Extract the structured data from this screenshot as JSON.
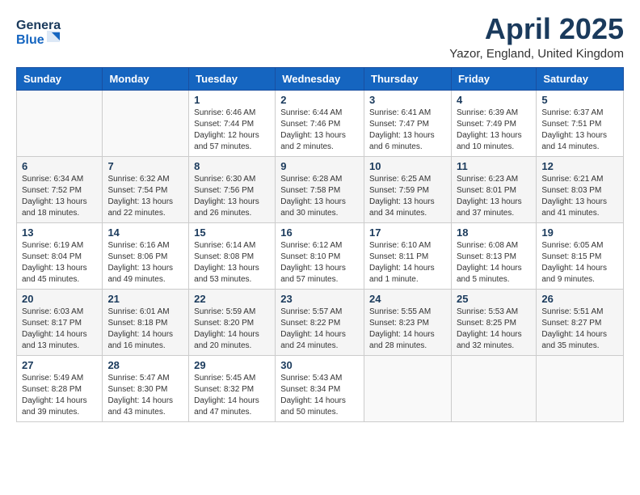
{
  "header": {
    "logo_line1": "General",
    "logo_line2": "Blue",
    "month_title": "April 2025",
    "location": "Yazor, England, United Kingdom"
  },
  "weekdays": [
    "Sunday",
    "Monday",
    "Tuesday",
    "Wednesday",
    "Thursday",
    "Friday",
    "Saturday"
  ],
  "rows": [
    [
      {
        "day": "",
        "sunrise": "",
        "sunset": "",
        "daylight": ""
      },
      {
        "day": "",
        "sunrise": "",
        "sunset": "",
        "daylight": ""
      },
      {
        "day": "1",
        "sunrise": "Sunrise: 6:46 AM",
        "sunset": "Sunset: 7:44 PM",
        "daylight": "Daylight: 12 hours and 57 minutes."
      },
      {
        "day": "2",
        "sunrise": "Sunrise: 6:44 AM",
        "sunset": "Sunset: 7:46 PM",
        "daylight": "Daylight: 13 hours and 2 minutes."
      },
      {
        "day": "3",
        "sunrise": "Sunrise: 6:41 AM",
        "sunset": "Sunset: 7:47 PM",
        "daylight": "Daylight: 13 hours and 6 minutes."
      },
      {
        "day": "4",
        "sunrise": "Sunrise: 6:39 AM",
        "sunset": "Sunset: 7:49 PM",
        "daylight": "Daylight: 13 hours and 10 minutes."
      },
      {
        "day": "5",
        "sunrise": "Sunrise: 6:37 AM",
        "sunset": "Sunset: 7:51 PM",
        "daylight": "Daylight: 13 hours and 14 minutes."
      }
    ],
    [
      {
        "day": "6",
        "sunrise": "Sunrise: 6:34 AM",
        "sunset": "Sunset: 7:52 PM",
        "daylight": "Daylight: 13 hours and 18 minutes."
      },
      {
        "day": "7",
        "sunrise": "Sunrise: 6:32 AM",
        "sunset": "Sunset: 7:54 PM",
        "daylight": "Daylight: 13 hours and 22 minutes."
      },
      {
        "day": "8",
        "sunrise": "Sunrise: 6:30 AM",
        "sunset": "Sunset: 7:56 PM",
        "daylight": "Daylight: 13 hours and 26 minutes."
      },
      {
        "day": "9",
        "sunrise": "Sunrise: 6:28 AM",
        "sunset": "Sunset: 7:58 PM",
        "daylight": "Daylight: 13 hours and 30 minutes."
      },
      {
        "day": "10",
        "sunrise": "Sunrise: 6:25 AM",
        "sunset": "Sunset: 7:59 PM",
        "daylight": "Daylight: 13 hours and 34 minutes."
      },
      {
        "day": "11",
        "sunrise": "Sunrise: 6:23 AM",
        "sunset": "Sunset: 8:01 PM",
        "daylight": "Daylight: 13 hours and 37 minutes."
      },
      {
        "day": "12",
        "sunrise": "Sunrise: 6:21 AM",
        "sunset": "Sunset: 8:03 PM",
        "daylight": "Daylight: 13 hours and 41 minutes."
      }
    ],
    [
      {
        "day": "13",
        "sunrise": "Sunrise: 6:19 AM",
        "sunset": "Sunset: 8:04 PM",
        "daylight": "Daylight: 13 hours and 45 minutes."
      },
      {
        "day": "14",
        "sunrise": "Sunrise: 6:16 AM",
        "sunset": "Sunset: 8:06 PM",
        "daylight": "Daylight: 13 hours and 49 minutes."
      },
      {
        "day": "15",
        "sunrise": "Sunrise: 6:14 AM",
        "sunset": "Sunset: 8:08 PM",
        "daylight": "Daylight: 13 hours and 53 minutes."
      },
      {
        "day": "16",
        "sunrise": "Sunrise: 6:12 AM",
        "sunset": "Sunset: 8:10 PM",
        "daylight": "Daylight: 13 hours and 57 minutes."
      },
      {
        "day": "17",
        "sunrise": "Sunrise: 6:10 AM",
        "sunset": "Sunset: 8:11 PM",
        "daylight": "Daylight: 14 hours and 1 minute."
      },
      {
        "day": "18",
        "sunrise": "Sunrise: 6:08 AM",
        "sunset": "Sunset: 8:13 PM",
        "daylight": "Daylight: 14 hours and 5 minutes."
      },
      {
        "day": "19",
        "sunrise": "Sunrise: 6:05 AM",
        "sunset": "Sunset: 8:15 PM",
        "daylight": "Daylight: 14 hours and 9 minutes."
      }
    ],
    [
      {
        "day": "20",
        "sunrise": "Sunrise: 6:03 AM",
        "sunset": "Sunset: 8:17 PM",
        "daylight": "Daylight: 14 hours and 13 minutes."
      },
      {
        "day": "21",
        "sunrise": "Sunrise: 6:01 AM",
        "sunset": "Sunset: 8:18 PM",
        "daylight": "Daylight: 14 hours and 16 minutes."
      },
      {
        "day": "22",
        "sunrise": "Sunrise: 5:59 AM",
        "sunset": "Sunset: 8:20 PM",
        "daylight": "Daylight: 14 hours and 20 minutes."
      },
      {
        "day": "23",
        "sunrise": "Sunrise: 5:57 AM",
        "sunset": "Sunset: 8:22 PM",
        "daylight": "Daylight: 14 hours and 24 minutes."
      },
      {
        "day": "24",
        "sunrise": "Sunrise: 5:55 AM",
        "sunset": "Sunset: 8:23 PM",
        "daylight": "Daylight: 14 hours and 28 minutes."
      },
      {
        "day": "25",
        "sunrise": "Sunrise: 5:53 AM",
        "sunset": "Sunset: 8:25 PM",
        "daylight": "Daylight: 14 hours and 32 minutes."
      },
      {
        "day": "26",
        "sunrise": "Sunrise: 5:51 AM",
        "sunset": "Sunset: 8:27 PM",
        "daylight": "Daylight: 14 hours and 35 minutes."
      }
    ],
    [
      {
        "day": "27",
        "sunrise": "Sunrise: 5:49 AM",
        "sunset": "Sunset: 8:28 PM",
        "daylight": "Daylight: 14 hours and 39 minutes."
      },
      {
        "day": "28",
        "sunrise": "Sunrise: 5:47 AM",
        "sunset": "Sunset: 8:30 PM",
        "daylight": "Daylight: 14 hours and 43 minutes."
      },
      {
        "day": "29",
        "sunrise": "Sunrise: 5:45 AM",
        "sunset": "Sunset: 8:32 PM",
        "daylight": "Daylight: 14 hours and 47 minutes."
      },
      {
        "day": "30",
        "sunrise": "Sunrise: 5:43 AM",
        "sunset": "Sunset: 8:34 PM",
        "daylight": "Daylight: 14 hours and 50 minutes."
      },
      {
        "day": "",
        "sunrise": "",
        "sunset": "",
        "daylight": ""
      },
      {
        "day": "",
        "sunrise": "",
        "sunset": "",
        "daylight": ""
      },
      {
        "day": "",
        "sunrise": "",
        "sunset": "",
        "daylight": ""
      }
    ]
  ]
}
